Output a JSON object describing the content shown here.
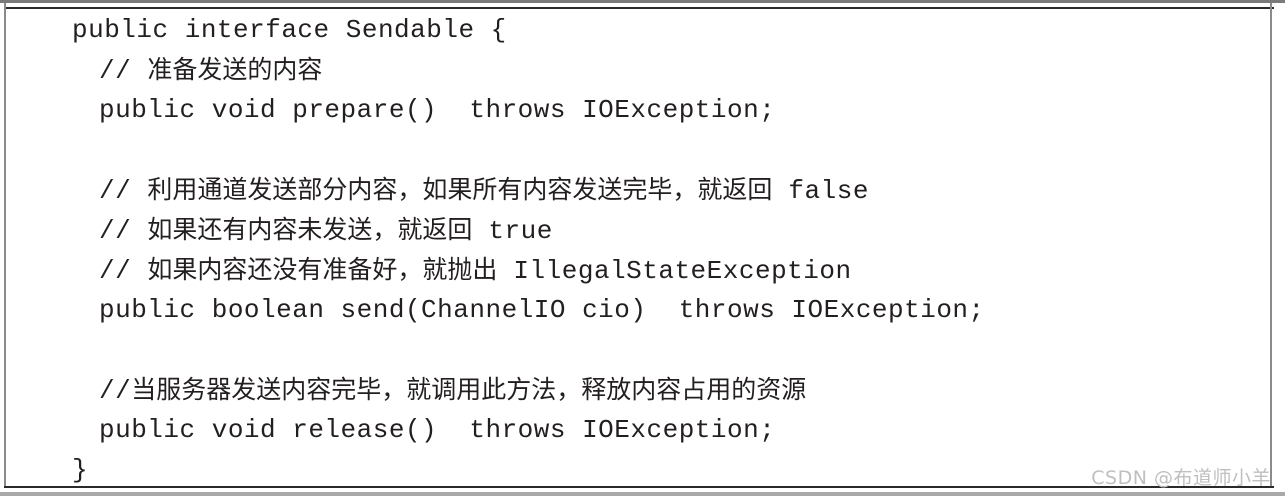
{
  "figure": {
    "name": "java-code-snippet",
    "background_color": "#ffffff",
    "text_color": "#231f20",
    "rule_color_dark": "#2a2a2a",
    "rule_color_light": "#8a8a8a"
  },
  "code": {
    "language": "java",
    "lines": [
      {
        "indent": 0,
        "text": "public interface Sendable {"
      },
      {
        "indent": 1,
        "text": "// 准备发送的内容"
      },
      {
        "indent": 1,
        "text": "public void prepare()  throws IOException;"
      },
      {
        "indent": 1,
        "text": ""
      },
      {
        "indent": 1,
        "text": "// 利用通道发送部分内容，如果所有内容发送完毕，就返回 false"
      },
      {
        "indent": 1,
        "text": "// 如果还有内容未发送，就返回 true"
      },
      {
        "indent": 1,
        "text": "// 如果内容还没有准备好，就抛出 IllegalStateException"
      },
      {
        "indent": 1,
        "text": "public boolean send(ChannelIO cio)  throws IOException;"
      },
      {
        "indent": 1,
        "text": ""
      },
      {
        "indent": 1,
        "text": "//当服务器发送内容完毕，就调用此方法，释放内容占用的资源"
      },
      {
        "indent": 1,
        "text": "public void release()  throws IOException;"
      },
      {
        "indent": 0,
        "text": "}"
      }
    ]
  },
  "watermark": {
    "text": "CSDN @布道师小羊",
    "color": "#bfbfbf"
  }
}
